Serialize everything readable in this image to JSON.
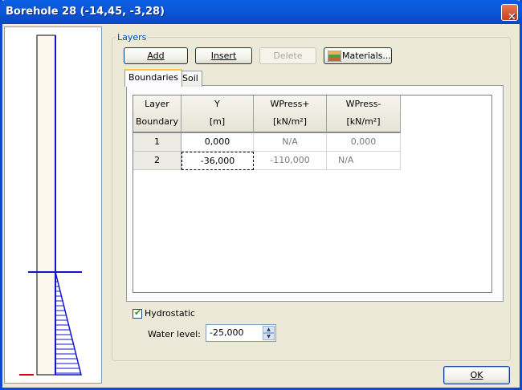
{
  "window": {
    "title": "Borehole 28 (-14,45, -3,28)",
    "close_glyph": "✕"
  },
  "layers_group": {
    "legend": "Layers"
  },
  "toolbar": {
    "add_label": "Add",
    "insert_label": "Insert",
    "delete_label": "Delete",
    "materials_label": "Materials..."
  },
  "tabs": [
    {
      "label": "Boundaries",
      "active": true
    },
    {
      "label": "Soil",
      "active": false
    }
  ],
  "table": {
    "columns": [
      {
        "line1": "Layer",
        "line2": "Boundary"
      },
      {
        "line1": "Y",
        "line2": "[m]"
      },
      {
        "line1": "WPress+",
        "line2": "[kN/m²]"
      },
      {
        "line1": "WPress-",
        "line2": "[kN/m²]"
      }
    ],
    "rows": [
      {
        "boundary": "1",
        "y": "0,000",
        "wpress_plus": "N/A",
        "wpress_minus": "0,000"
      },
      {
        "boundary": "2",
        "y": "-36,000",
        "wpress_plus": "-110,000",
        "wpress_minus": "N/A"
      }
    ]
  },
  "hydrostatic": {
    "label": "Hydrostatic",
    "checked": true,
    "check_glyph": "✔"
  },
  "water_level": {
    "label": "Water level:",
    "value": "-25,000",
    "up_glyph": "▲",
    "down_glyph": "▼"
  },
  "ok_label": "OK",
  "colors": {
    "boundary_line": "#1414c8",
    "marker": "#e00000"
  }
}
